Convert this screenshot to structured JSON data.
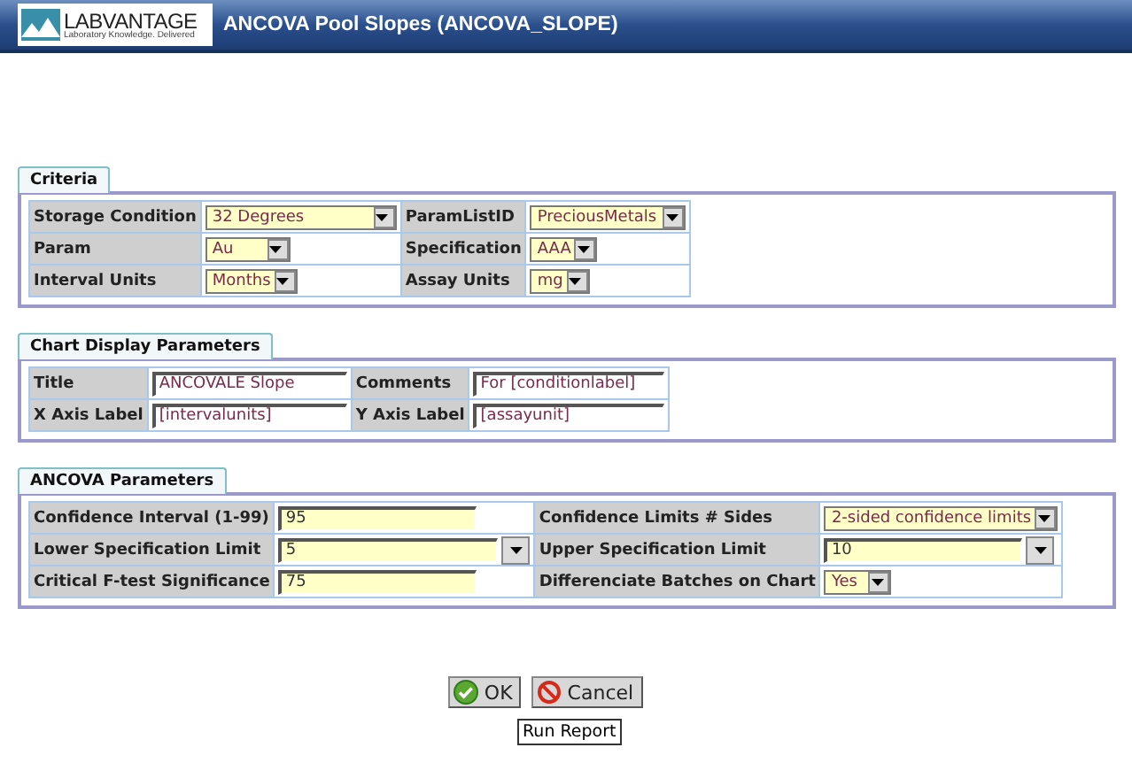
{
  "window": {
    "title": "ANCOVA Pool Slopes (ANCOVA_SLOPE)",
    "logo": {
      "brand": "LABVANTAGE",
      "tagline": "Laboratory Knowledge. Delivered"
    }
  },
  "sections": [
    {
      "title": "Criteria",
      "rows": [
        [
          {
            "label": "Storage Condition",
            "kind": "select",
            "value": "32 Degrees"
          },
          {
            "label": "ParamListID",
            "kind": "select",
            "value": "PreciousMetals"
          }
        ],
        [
          {
            "label": "Param",
            "kind": "select",
            "value": "Au"
          },
          {
            "label": "Specification",
            "kind": "select",
            "value": "AAA"
          }
        ],
        [
          {
            "label": "Interval Units",
            "kind": "select",
            "value": "Months"
          },
          {
            "label": "Assay Units",
            "kind": "select",
            "value": "mg"
          }
        ]
      ]
    },
    {
      "title": "Chart Display Parameters",
      "rows": [
        [
          {
            "label": "Title",
            "kind": "text",
            "value": "ANCOVALE Slope"
          },
          {
            "label": "Comments",
            "kind": "text",
            "value": "For [conditionlabel]"
          }
        ],
        [
          {
            "label": "X Axis Label",
            "kind": "text",
            "value": "[intervalunits]"
          },
          {
            "label": "Y Axis Label",
            "kind": "text",
            "value": "[assayunit]"
          }
        ]
      ]
    },
    {
      "title": "ANCOVA Parameters",
      "rows": [
        [
          {
            "label": "Confidence Interval (1-99)",
            "kind": "text",
            "value": "95"
          },
          {
            "label": "Confidence Limits # Sides",
            "kind": "select",
            "value": "2-sided confidence limits"
          }
        ],
        [
          {
            "label": "Lower Specification Limit",
            "kind": "combo",
            "value": "5"
          },
          {
            "label": "Upper Specification Limit",
            "kind": "combo",
            "value": "10"
          }
        ],
        [
          {
            "label": "Critical F-test Significance",
            "kind": "text",
            "value": "75"
          },
          {
            "label": "Differenciate Batches on Chart",
            "kind": "select",
            "value": "Yes"
          }
        ]
      ]
    }
  ],
  "buttons": [
    {
      "label": "OK",
      "kind": "ok"
    },
    {
      "label": "Cancel",
      "kind": "cancel"
    }
  ],
  "tooltip": "Run Report"
}
